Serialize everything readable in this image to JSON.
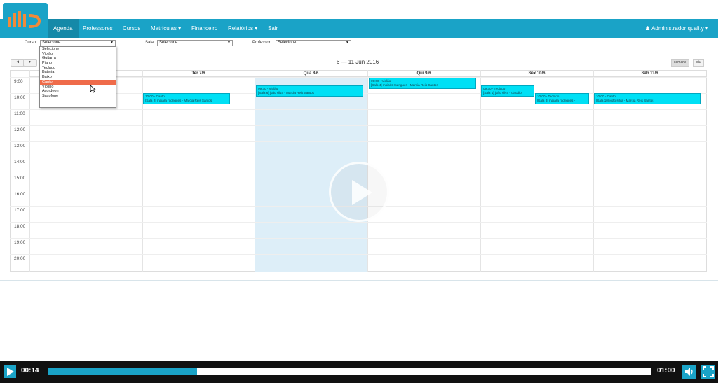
{
  "nav": {
    "items": [
      "Agenda",
      "Professores",
      "Cursos",
      "Matrículas ▾",
      "Financeiro",
      "Relatórios ▾",
      "Sair"
    ],
    "user": "Administrador quality ▾"
  },
  "filters": {
    "curso_label": "Curso:",
    "curso_value": "Selecione",
    "sala_label": "Sala:",
    "sala_value": "Selecione",
    "professor_label": "Professor:",
    "professor_value": "Selecione"
  },
  "dropdown": {
    "options": [
      "Selecione",
      "Violão",
      "Guitarra",
      "Piano",
      "Teclado",
      "Bateria",
      "Baixo",
      "Canto",
      "Violino",
      "Acordeon",
      "Saxofone"
    ],
    "highlighted": "Canto"
  },
  "calendar": {
    "prev": "◄",
    "next": "►",
    "title": "6 — 11 Jun 2016",
    "views": [
      "semana",
      "dia"
    ],
    "days": [
      "Seg 6/6",
      "Ter 7/6",
      "Qua 8/6",
      "Qui 9/6",
      "Sex 10/6",
      "Sáb 11/6"
    ],
    "times": [
      "9:00",
      "10:00",
      "11:00",
      "12:00",
      "13:00",
      "14:00",
      "15:00",
      "16:00",
      "17:00",
      "18:00",
      "19:00",
      "20:00"
    ]
  },
  "events": [
    {
      "title": "10:00 - Canto",
      "desc": "[Sala 2] maiara rodrigues - Marcia Reis Santos"
    },
    {
      "title": "09:30 - Violão",
      "desc": "[Sala 6] joão silva - Marcia Reis Santos"
    },
    {
      "title": "09:00 - Violão",
      "desc": "[Sala 4] moisés rodrigues - Marcia Reis Santos"
    },
    {
      "title": "09:30 - Teclado",
      "desc": "[Sala 1] joão silva - claudio"
    },
    {
      "title": "10:00 - Teclado",
      "desc": "[Sala 8] maiara rodrigues -"
    },
    {
      "title": "10:00 - Canto",
      "desc": "[Sala 10] joão silva - Marcia Reis Santos"
    }
  ],
  "video": {
    "current": "00:14",
    "duration": "01:00",
    "progress": 0.246
  },
  "colors": {
    "primary": "#1aa3c7",
    "event": "#00e0f5",
    "highlight": "#ef6b4a"
  }
}
